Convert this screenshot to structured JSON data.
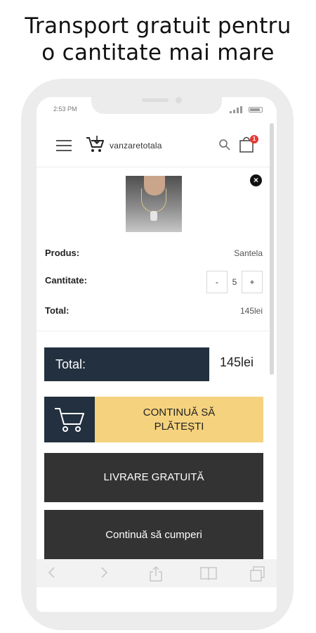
{
  "headline": {
    "line1": "Transport gratuit pentru",
    "line2": "o cantitate mai mare"
  },
  "status_bar": {
    "time": "2:53 PM"
  },
  "app_bar": {
    "brand": "vanzaretotala",
    "cart_count": "1",
    "icons": [
      "menu-icon",
      "logo-cart-icon",
      "search-icon",
      "shopping-bag-icon"
    ]
  },
  "cart_item": {
    "product_label": "Produs:",
    "product_value": "Santela",
    "quantity_label": "Cantitate:",
    "quantity_minus": "-",
    "quantity_value": "5",
    "quantity_plus": "+",
    "total_label": "Total:",
    "total_value": "145lei",
    "remove_icon": "×"
  },
  "summary": {
    "total_label": "Total:",
    "total_amount": "145lei"
  },
  "actions": {
    "checkout_line1": "CONTINUĂ SĂ",
    "checkout_line2": "PLĂTEȘTI",
    "free_shipping": "LIVRARE GRATUITĂ",
    "continue_shopping": "Continuă să cumperi"
  },
  "colors": {
    "navy": "#22303f",
    "gold": "#f5d27e",
    "dark_button": "#333333",
    "badge": "#e53935"
  },
  "browser_nav_icons": [
    "back-icon",
    "forward-icon",
    "share-icon",
    "bookmarks-icon",
    "tabs-icon"
  ]
}
